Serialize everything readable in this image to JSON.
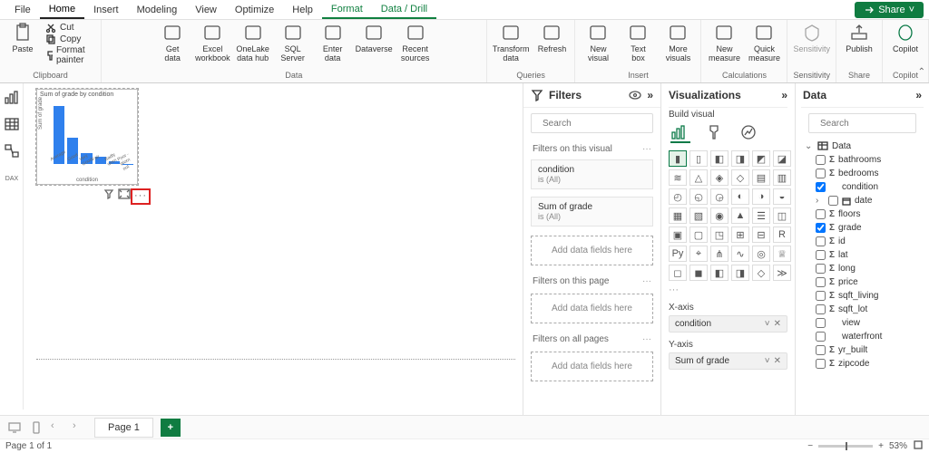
{
  "menu": {
    "items": [
      "File",
      "Home",
      "Insert",
      "Modeling",
      "View",
      "Optimize",
      "Help",
      "Format",
      "Data / Drill"
    ],
    "share": "Share"
  },
  "ribbon": {
    "clipboard": {
      "label": "Clipboard",
      "paste": "Paste",
      "cut": "Cut",
      "copy": "Copy",
      "fmt": "Format painter"
    },
    "data": {
      "label": "Data",
      "items": [
        "Get\ndata",
        "Excel\nworkbook",
        "OneLake\ndata hub",
        "SQL\nServer",
        "Enter\ndata",
        "Dataverse",
        "Recent\nsources"
      ]
    },
    "queries": {
      "label": "Queries",
      "items": [
        "Transform\ndata",
        "Refresh"
      ]
    },
    "insert": {
      "label": "Insert",
      "items": [
        "New\nvisual",
        "Text\nbox",
        "More\nvisuals"
      ]
    },
    "calc": {
      "label": "Calculations",
      "items": [
        "New\nmeasure",
        "Quick\nmeasure"
      ]
    },
    "sens": {
      "label": "Sensitivity",
      "item": "Sensitivity"
    },
    "share": {
      "label": "Share",
      "item": "Publish"
    },
    "copilot": {
      "label": "Copilot",
      "item": "Copilot"
    }
  },
  "filters": {
    "title": "Filters",
    "search_ph": "Search",
    "sec1": "Filters on this visual",
    "card1": {
      "l1": "condition",
      "l2": "is (All)"
    },
    "card2": {
      "l1": "Sum of grade",
      "l2": "is (All)"
    },
    "drop": "Add data fields here",
    "sec2": "Filters on this page",
    "sec3": "Filters on all pages"
  },
  "vis": {
    "title": "Visualizations",
    "sub": "Build visual",
    "xaxis_label": "X-axis",
    "xaxis_field": "condition",
    "yaxis_label": "Y-axis",
    "yaxis_field": "Sum of grade",
    "dots": "···"
  },
  "data": {
    "title": "Data",
    "search_ph": "Search",
    "table": "Data",
    "fields": [
      {
        "name": "bathrooms",
        "sigma": true,
        "checked": false
      },
      {
        "name": "bedrooms",
        "sigma": true,
        "checked": false
      },
      {
        "name": "condition",
        "sigma": false,
        "checked": true
      },
      {
        "name": "date",
        "sigma": false,
        "checked": false,
        "expandable": true
      },
      {
        "name": "floors",
        "sigma": true,
        "checked": false
      },
      {
        "name": "grade",
        "sigma": true,
        "checked": true
      },
      {
        "name": "id",
        "sigma": true,
        "checked": false
      },
      {
        "name": "lat",
        "sigma": true,
        "checked": false
      },
      {
        "name": "long",
        "sigma": true,
        "checked": false
      },
      {
        "name": "price",
        "sigma": true,
        "checked": false
      },
      {
        "name": "sqft_living",
        "sigma": true,
        "checked": false
      },
      {
        "name": "sqft_lot",
        "sigma": true,
        "checked": false
      },
      {
        "name": "view",
        "sigma": false,
        "checked": false
      },
      {
        "name": "waterfront",
        "sigma": false,
        "checked": false
      },
      {
        "name": "yr_built",
        "sigma": true,
        "checked": false
      },
      {
        "name": "zipcode",
        "sigma": true,
        "checked": false
      }
    ]
  },
  "footer": {
    "page": "Page 1",
    "status": "Page 1 of 1",
    "zoom": "53%"
  },
  "chart_data": {
    "type": "bar",
    "title": "Sum of grade by condition",
    "xlabel": "condition",
    "ylabel": "Sum of grade",
    "categories": [
      "Average",
      "Good",
      "Very Good",
      "Fair",
      "Badly worn",
      "Poor - Worn out"
    ],
    "values": [
      100000,
      46000,
      18000,
      12000,
      5000,
      500
    ],
    "ylim": [
      0,
      100000
    ]
  }
}
